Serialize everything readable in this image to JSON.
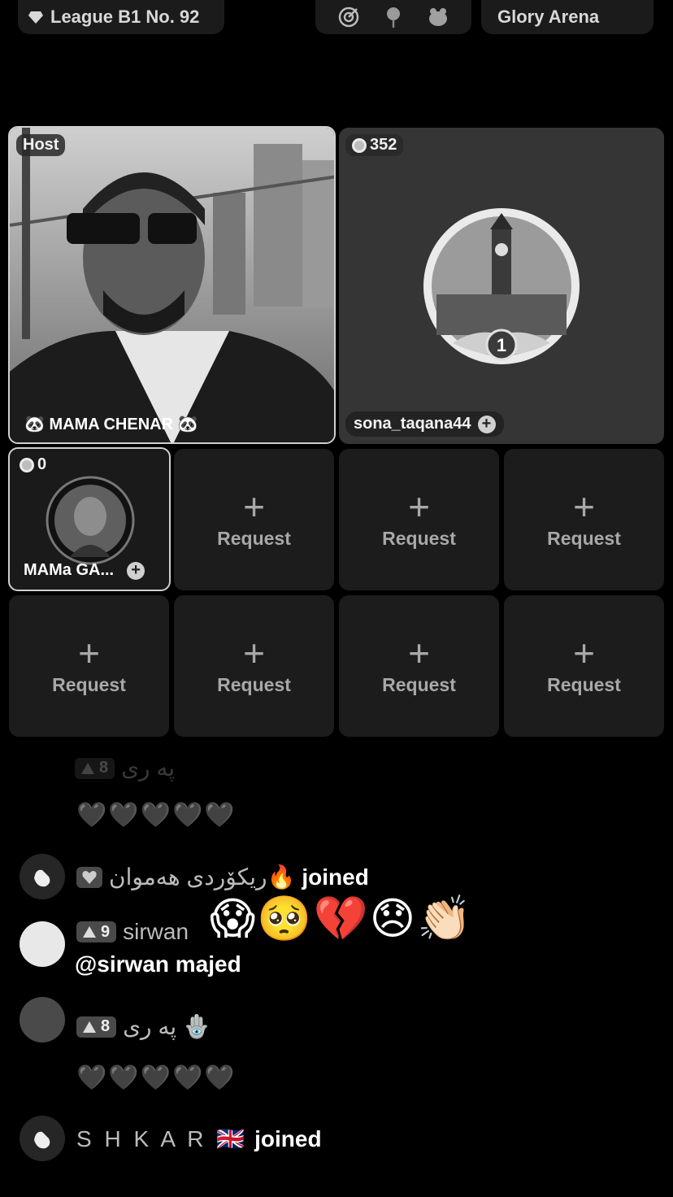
{
  "topbar": {
    "league": "League B1 No. 92",
    "arena": "Glory Arena"
  },
  "host": {
    "tag": "Host",
    "name": "🐼 MAMA CHENAR 🐼"
  },
  "guest": {
    "coins": "352",
    "name": "sona_taqana44",
    "rank": "1"
  },
  "small_guest": {
    "coins": "0",
    "name": "MAMa GA..."
  },
  "request_label": "Request",
  "request_plus": "+",
  "chat": {
    "msg0": {
      "badge": "8",
      "name": "په ری",
      "hearts": "🖤🖤🖤🖤🖤"
    },
    "msg1": {
      "name": "ریکۆردی هەموان🔥",
      "action": "joined"
    },
    "msg2": {
      "badge": "9",
      "name": "sirwan",
      "mention": "@sirwan majed"
    },
    "emojis": "😱🥺💔😞👏🏻",
    "msg3": {
      "badge": "8",
      "name": "په ری 🪬",
      "hearts": "🖤🖤🖤🖤🖤"
    },
    "msg4": {
      "name": "S H K A R 🇬🇧",
      "action": "joined"
    }
  },
  "colors": {
    "background": "#000000",
    "tile": "#1c1c1c",
    "text_muted": "#a8a8a8"
  }
}
